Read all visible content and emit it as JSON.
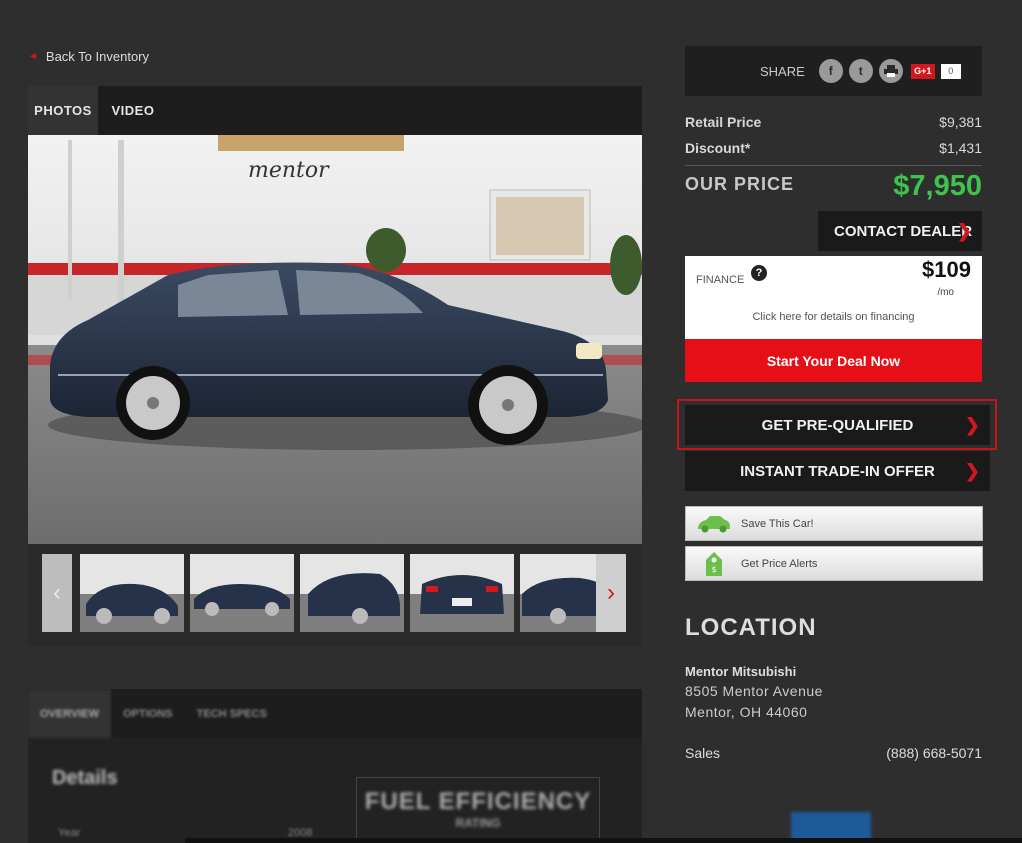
{
  "back_link": "Back To Inventory",
  "media_tabs": [
    "PHOTOS",
    "VIDEO"
  ],
  "photo": {
    "dealer_sign": "mentor"
  },
  "thumbnails": {
    "count": 5
  },
  "info_tabs": [
    "OVERVIEW",
    "OPTIONS",
    "TECH SPECS"
  ],
  "details": {
    "title": "Details",
    "year_label": "Year",
    "year_value": "2008",
    "fuel_title": "FUEL EFFICIENCY",
    "fuel_sub": "RATING"
  },
  "share": {
    "label": "SHARE",
    "icons": [
      "f",
      "t",
      "print",
      "G+1"
    ],
    "gplus_label": "G+1",
    "gplus_count": "0"
  },
  "pricing": {
    "retail_label": "Retail Price",
    "retail_value": "$9,381",
    "discount_label": "Discount*",
    "discount_value": "$1,431",
    "our_label": "OUR PRICE",
    "our_value": "$7,950"
  },
  "contact_dealer": "CONTACT DEALER",
  "finance": {
    "label": "FINANCE",
    "amount": "$109",
    "per": "/mo",
    "click_text": "Click here for details on financing"
  },
  "start_deal": "Start Your Deal Now",
  "get_prequalified": "GET PRE-QUALIFIED",
  "trade_in": "INSTANT TRADE-IN OFFER",
  "save_car": "Save This Car!",
  "price_alerts": "Get Price Alerts",
  "location": {
    "title": "LOCATION",
    "dealer": "Mentor Mitsubishi",
    "address1": "8505 Mentor Avenue",
    "address2": "Mentor, OH 44060",
    "sales_label": "Sales",
    "sales_phone": "(888) 668-5071"
  },
  "colors": {
    "accent_red": "#e60f17",
    "price_green": "#3fc34f",
    "panel_dark": "#1a1a1a"
  }
}
